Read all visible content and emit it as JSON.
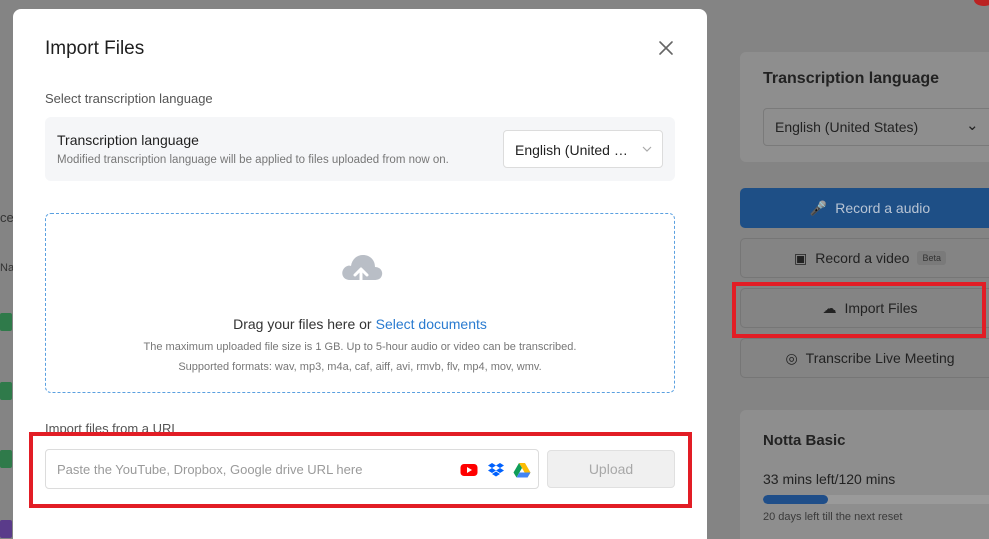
{
  "background": {
    "left_fragments": [
      "ce",
      "Na"
    ],
    "right_panel": {
      "title": "Transcription language",
      "language_value": "English (United States)"
    },
    "actions": {
      "record_audio": "Record a audio",
      "record_video": "Record a video",
      "record_video_badge": "Beta",
      "import_files": "Import Files",
      "transcribe_live": "Transcribe Live Meeting"
    },
    "plan": {
      "name": "Notta Basic",
      "usage": "33 mins left/120 mins",
      "used_fraction": 0.27,
      "reset_text": "20 days left till the next reset"
    }
  },
  "modal": {
    "title": "Import Files",
    "language_section_label": "Select transcription language",
    "language_box": {
      "title": "Transcription language",
      "subtitle": "Modified transcription language will be applied to files uploaded from now on.",
      "selected_value": "English (United States)"
    },
    "dropzone": {
      "main_text": "Drag your files here or",
      "link_text": "Select documents",
      "size_hint": "The maximum uploaded file size is 1 GB. Up to 5-hour audio or video can be transcribed.",
      "formats_hint": "Supported formats: wav, mp3, m4a, caf, aiff, avi, rmvb, flv, mp4, mov, wmv."
    },
    "url_section": {
      "label": "Import files from a URL",
      "placeholder": "Paste the YouTube, Dropbox, Google drive URL here",
      "value": "",
      "upload_label": "Upload"
    }
  },
  "colors": {
    "accent": "#2a7bd0",
    "highlight": "#e21d25",
    "youtube": "#ff0000",
    "dropbox": "#0061fe"
  }
}
